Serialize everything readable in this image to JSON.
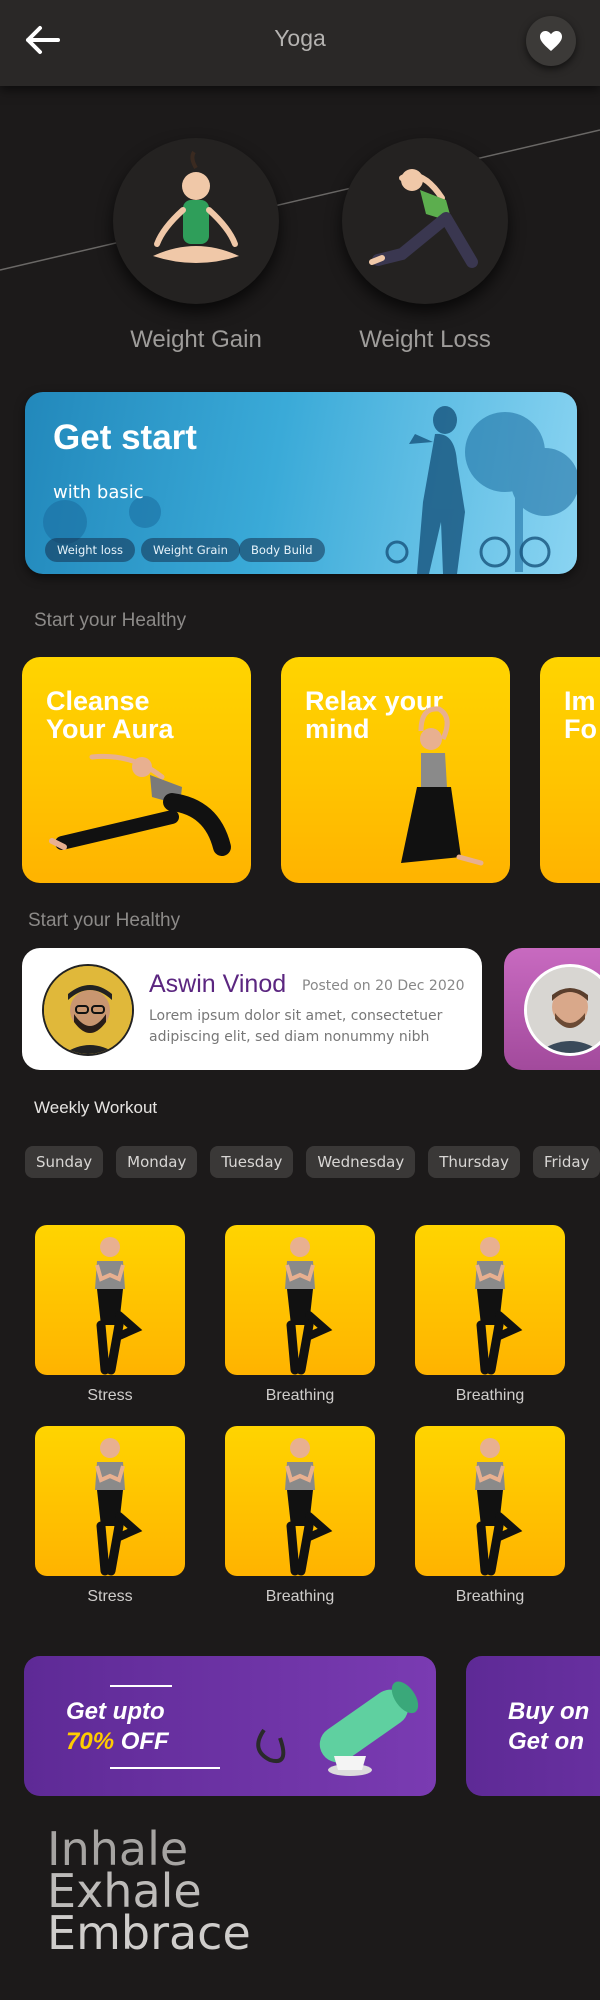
{
  "header": {
    "title": "Yoga"
  },
  "goals": [
    {
      "label": "Weight Gain"
    },
    {
      "label": "Weight Loss"
    }
  ],
  "banner": {
    "title": "Get start",
    "subtitle": "with basic",
    "chips": [
      "Weight loss",
      "Weight Grain",
      "Body Build"
    ]
  },
  "sections": {
    "healthy_1": "Start your Healthy",
    "healthy_2": "Start your Healthy",
    "weekly": "Weekly Workout"
  },
  "cards": [
    {
      "title_line1": "Cleanse",
      "title_line2": "Your Aura"
    },
    {
      "title_line1": "Relax your",
      "title_line2": "mind"
    },
    {
      "title_line1": "Im",
      "title_line2": "Fo"
    }
  ],
  "profile": {
    "name": "Aswin Vinod",
    "posted": "Posted on 20 Dec 2020",
    "description": "Lorem ipsum dolor sit amet, consectetuer adipiscing elit, sed diam nonummy nibh"
  },
  "days": [
    "Sunday",
    "Monday",
    "Tuesday",
    "Wednesday",
    "Thursday",
    "Friday"
  ],
  "workouts": [
    {
      "label": "Stress"
    },
    {
      "label": "Breathing"
    },
    {
      "label": "Breathing"
    },
    {
      "label": "Stress"
    },
    {
      "label": "Breathing"
    },
    {
      "label": "Breathing"
    }
  ],
  "promos": [
    {
      "line1": "Get upto",
      "highlight": "70%",
      "rest": " OFF"
    },
    {
      "line1": "Buy on",
      "highlight": "",
      "rest": "Get on"
    }
  ],
  "tagline": [
    "Inhale",
    "Exhale",
    "Embrace"
  ],
  "colors": {
    "background": "#1c1a1a",
    "card_yellow": "#ffc400",
    "profile_name": "#5b2680",
    "promo_purple": "#6a2fa4",
    "promo_highlight": "#ffcc00"
  }
}
